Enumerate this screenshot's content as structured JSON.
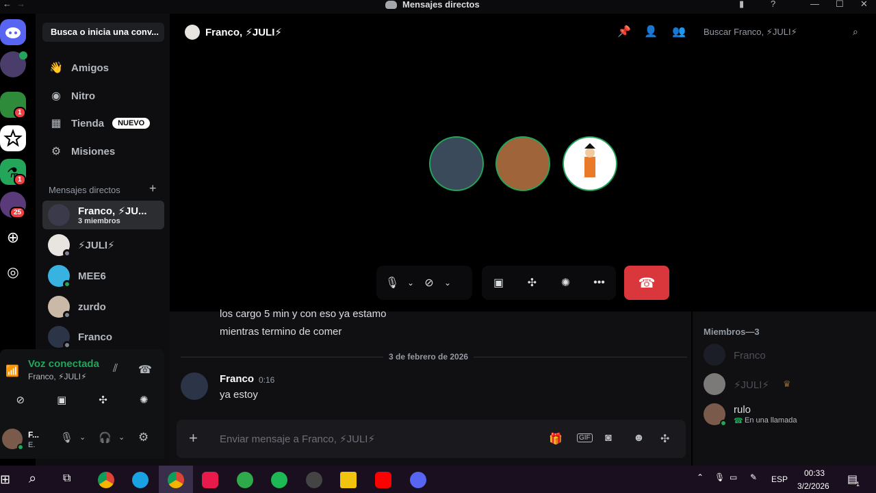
{
  "window": {
    "title": "Mensajes directos"
  },
  "sidebar": {
    "search_label": "Busca o inicia una conv...",
    "nav": [
      {
        "label": "Amigos",
        "icon": "friends-icon"
      },
      {
        "label": "Nitro",
        "icon": "nitro-icon"
      },
      {
        "label": "Tienda",
        "icon": "shop-icon",
        "badge": "NUEVO"
      },
      {
        "label": "Misiones",
        "icon": "quests-icon"
      }
    ],
    "dm_section": "Mensajes directos",
    "dms": [
      {
        "name": "Franco, ⚡JU...",
        "sub": "3 miembros",
        "active": true
      },
      {
        "name": "⚡JULI⚡"
      },
      {
        "name": "MEE6"
      },
      {
        "name": "zurdo"
      },
      {
        "name": "Franco"
      }
    ]
  },
  "guilds": {
    "badges": [
      "1",
      "1",
      "25"
    ]
  },
  "voice": {
    "status": "Voz conectada",
    "channel": "Franco, ⚡JULI⚡"
  },
  "user": {
    "name": "F...",
    "status": "E."
  },
  "header": {
    "title": "Franco, ⚡JULI⚡",
    "search_placeholder": "Buscar Franco, ⚡JULI⚡"
  },
  "chat": {
    "messages_prev": [
      "los cargo 5 min y con eso ya estamo",
      "mientras termino de comer"
    ],
    "date_divider": "3 de febrero de 2026",
    "message": {
      "author": "Franco",
      "time": "0:16",
      "text": "ya estoy"
    },
    "input_placeholder": "Enviar mensaje a Franco, ⚡JULI⚡"
  },
  "members": {
    "title": "Miembros—3",
    "list": [
      {
        "name": "Franco",
        "faded": true
      },
      {
        "name": "⚡JULI⚡",
        "faded": true,
        "crown": true
      },
      {
        "name": "rulo",
        "status": "En una llamada"
      }
    ]
  },
  "taskbar": {
    "lang": "ESP",
    "time": "00:33",
    "date": "3/2/2026",
    "notif": "1"
  },
  "colors": {
    "accent": "#5865f2",
    "online": "#23a55a",
    "danger": "#da373c"
  }
}
